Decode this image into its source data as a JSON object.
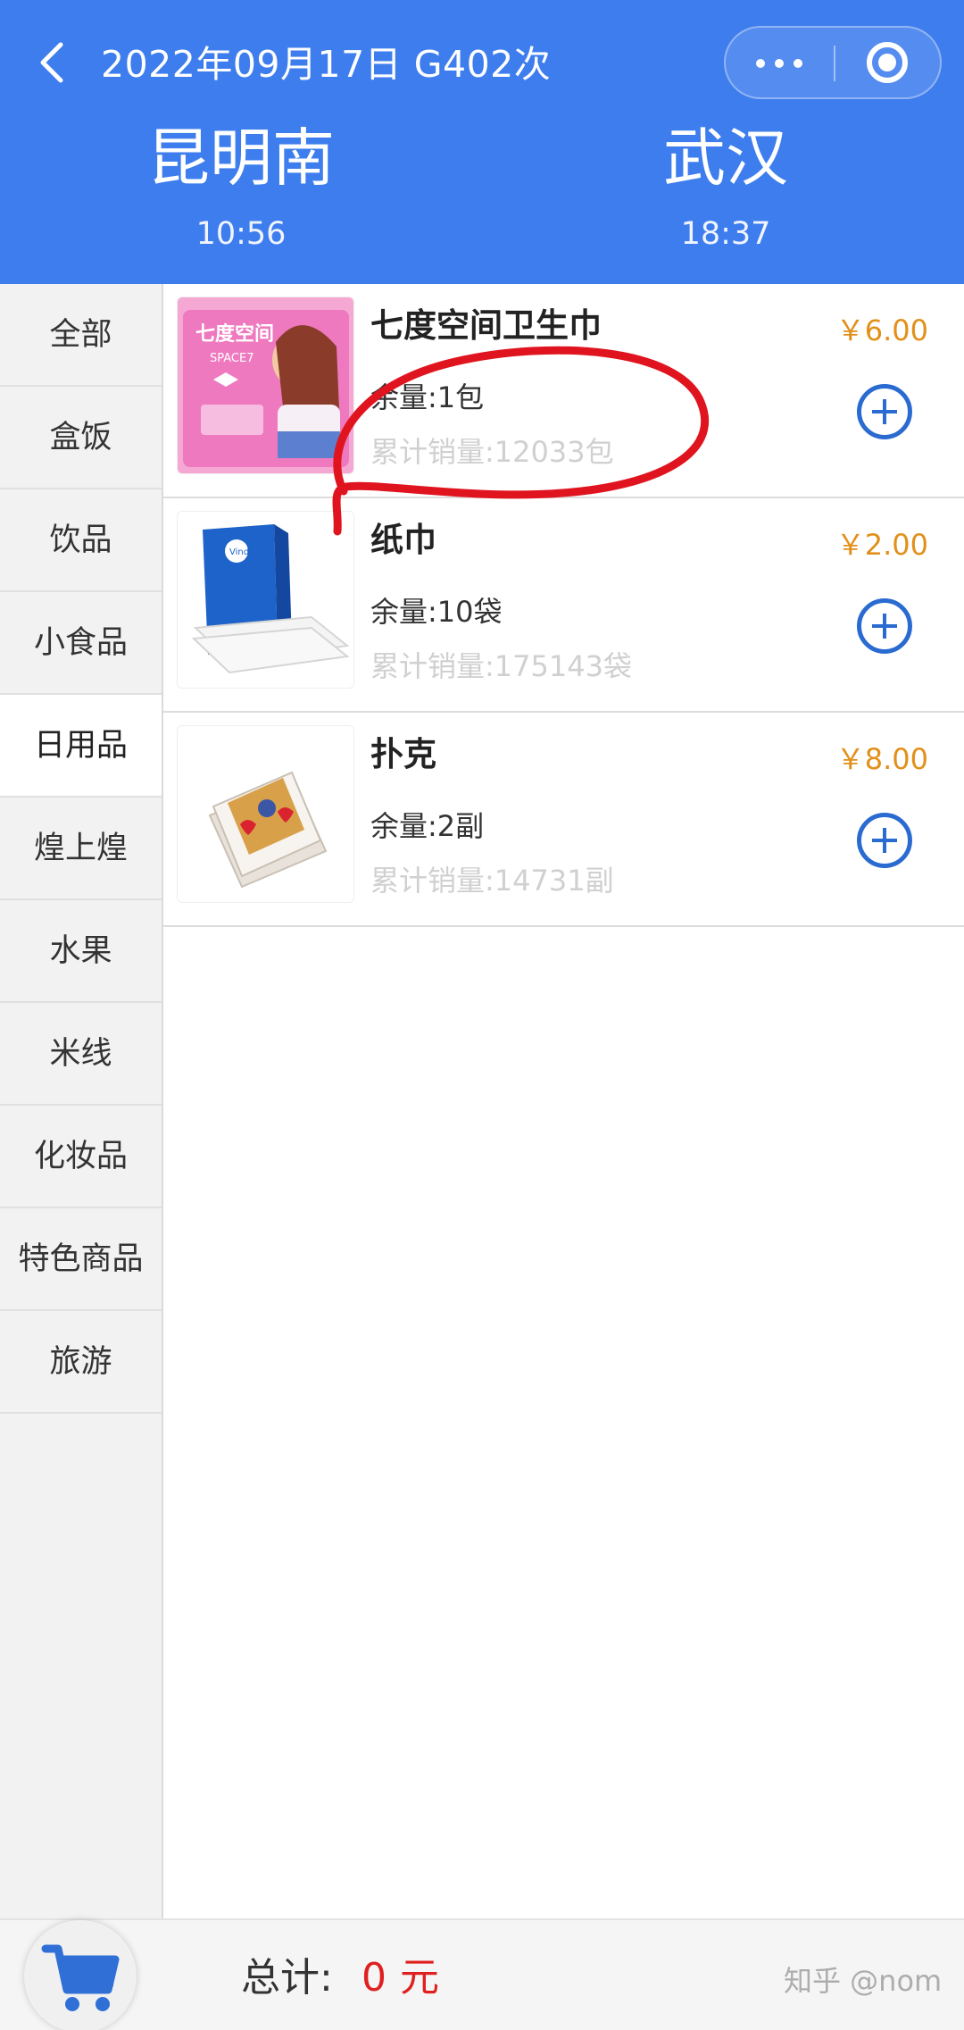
{
  "header": {
    "trip_info": "2022年09月17日 G402次",
    "from_station": "昆明南",
    "from_time": "10:56",
    "to_station": "武汉",
    "to_time": "18:37",
    "background_color": "#3e7ded"
  },
  "sidebar": {
    "items": [
      {
        "label": "全部"
      },
      {
        "label": "盒饭"
      },
      {
        "label": "饮品"
      },
      {
        "label": "小食品"
      },
      {
        "label": "日用品",
        "active": true
      },
      {
        "label": "煌上煌"
      },
      {
        "label": "水果"
      },
      {
        "label": "米线"
      },
      {
        "label": "化妆品"
      },
      {
        "label": "特色商品"
      },
      {
        "label": "旅游"
      }
    ]
  },
  "products": [
    {
      "name": "七度空间卫生巾",
      "stock": "余量:1包",
      "sold": "累计销量:12033包",
      "price": "￥6.00",
      "image": "sanitary-pad-package",
      "package_text": "七度空间",
      "package_subtext": "SPACE7"
    },
    {
      "name": "纸巾",
      "stock": "余量:10袋",
      "sold": "累计销量:175143袋",
      "price": "￥2.00",
      "image": "tissue-pack",
      "package_text": "Vinda"
    },
    {
      "name": "扑克",
      "stock": "余量:2副",
      "sold": "累计销量:14731副",
      "price": "￥8.00",
      "image": "playing-cards"
    }
  ],
  "footer": {
    "total_label": "总计:",
    "total_amount": "0",
    "total_unit": "元",
    "watermark": "知乎 @nom"
  },
  "colors": {
    "accent": "#3e7ded",
    "price": "#e2901a",
    "add_button": "#2a6bd1",
    "total": "#e02020",
    "annotation": "#e0141e"
  },
  "icons": {
    "back": "chevron-left-icon",
    "more": "more-dots-icon",
    "target": "target-icon",
    "add": "plus-circle-icon",
    "cart": "cart-icon"
  }
}
